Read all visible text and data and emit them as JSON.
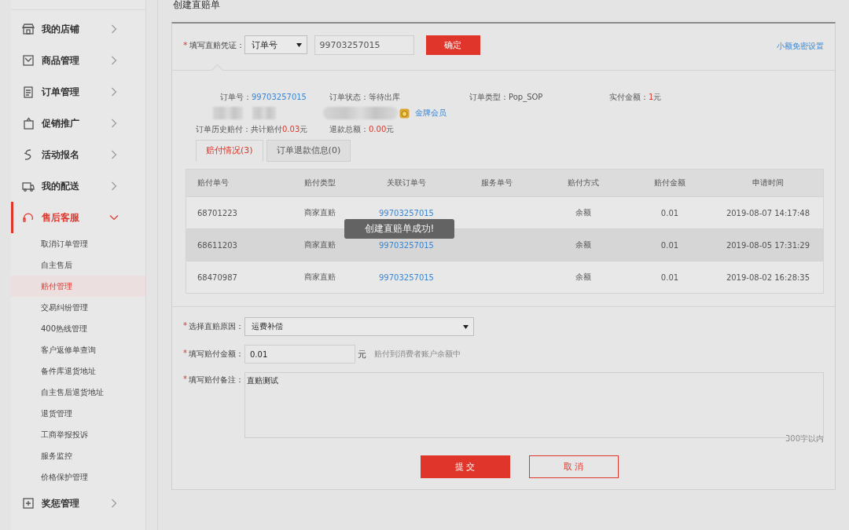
{
  "sidebar": {
    "items": [
      {
        "label": "我的店铺",
        "expanded": false,
        "selected": false
      },
      {
        "label": "商品管理",
        "expanded": false,
        "selected": false
      },
      {
        "label": "订单管理",
        "expanded": false,
        "selected": false
      },
      {
        "label": "促销推广",
        "expanded": false,
        "selected": false
      },
      {
        "label": "活动报名",
        "expanded": false,
        "selected": false
      },
      {
        "label": "我的配送",
        "expanded": false,
        "selected": false
      },
      {
        "label": "售后客服",
        "expanded": true,
        "selected": true,
        "children": [
          {
            "label": "取消订单管理",
            "selected": false
          },
          {
            "label": "自主售后",
            "selected": false
          },
          {
            "label": "赔付管理",
            "selected": true
          },
          {
            "label": "交易纠纷管理",
            "selected": false
          },
          {
            "label": "400热线管理",
            "selected": false
          },
          {
            "label": "客户返修单查询",
            "selected": false
          },
          {
            "label": "备件库退货地址",
            "selected": false
          },
          {
            "label": "自主售后退货地址",
            "selected": false
          },
          {
            "label": "退货管理",
            "selected": false
          },
          {
            "label": "工商举报投诉",
            "selected": false
          },
          {
            "label": "服务监控",
            "selected": false
          },
          {
            "label": "价格保护管理",
            "selected": false
          }
        ]
      },
      {
        "label": "奖惩管理",
        "expanded": false,
        "selected": false
      }
    ]
  },
  "page_title": "创建直赔单",
  "voucher": {
    "label": "填写直赔凭证：",
    "required_mark": "*",
    "select_value": "订单号",
    "input_value": "99703257015",
    "button": "确定",
    "link": "小额免密设置"
  },
  "order_info": {
    "fields": [
      {
        "kind": "link",
        "label": "订单号：",
        "value": "99703257015"
      },
      {
        "kind": "text",
        "label": "订单状态：",
        "value": "等待出库"
      },
      {
        "kind": "text",
        "label": "订单类型：",
        "value": "Pop_SOP"
      },
      {
        "kind": "amount",
        "label": "实付金额：",
        "value": "1",
        "unit": "元"
      }
    ],
    "member_badge": "金牌会员",
    "summary": [
      {
        "label": "订单历史赔付：",
        "text": "共计赔付",
        "value": "0.03",
        "unit": "元"
      },
      {
        "label": "退款总额：",
        "value": "0.00",
        "unit": "元"
      }
    ]
  },
  "tabs": [
    {
      "label": "赔付情况(3)",
      "selected": true
    },
    {
      "label": "订单退款信息(0)",
      "selected": false
    }
  ],
  "table": {
    "columns": [
      "赔付单号",
      "赔付类型",
      "关联订单号",
      "服务单号",
      "赔付方式",
      "赔付金额",
      "申请时间"
    ],
    "rows": [
      {
        "selected": false,
        "cells": [
          "68701223",
          "商家直赔",
          "99703257015",
          "",
          "余额",
          "0.01",
          "2019-08-07 14:17:48"
        ]
      },
      {
        "selected": true,
        "cells": [
          "68611203",
          "商家直赔",
          "99703257015",
          "",
          "余额",
          "0.01",
          "2019-08-05 17:31:29"
        ]
      },
      {
        "selected": false,
        "cells": [
          "68470987",
          "商家直赔",
          "99703257015",
          "",
          "余额",
          "0.01",
          "2019-08-02 16:28:35"
        ]
      }
    ]
  },
  "toast": "创建直赔单成功!",
  "form": {
    "reason": {
      "label": "选择直赔原因：",
      "required_mark": "*",
      "value": "运费补偿"
    },
    "amount": {
      "label": "填写赔付金额：",
      "required_mark": "*",
      "value": "0.01",
      "unit": "元",
      "hint": "赔付到消费者账户余额中"
    },
    "note": {
      "label": "填写赔付备注：",
      "required_mark": "*",
      "value": "直赔测试",
      "counter": "300字以内"
    },
    "submit": "提 交",
    "cancel": "取 消"
  }
}
